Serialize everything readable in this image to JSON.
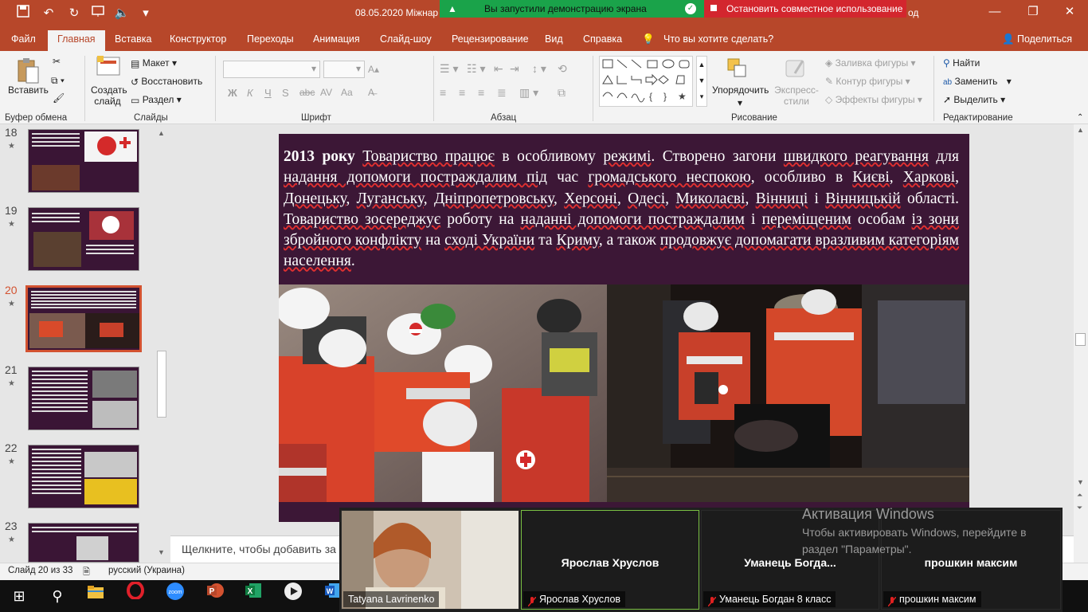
{
  "titlebar": {
    "doc_title": "08.05.2020 Міжнар",
    "behind_text": "од",
    "share_status": "Вы запустили демонстрацию экрана",
    "stop_share": "Остановить совместное использование"
  },
  "tabs": [
    {
      "label": "Файл"
    },
    {
      "label": "Главная",
      "active": true
    },
    {
      "label": "Вставка"
    },
    {
      "label": "Конструктор"
    },
    {
      "label": "Переходы"
    },
    {
      "label": "Анимация"
    },
    {
      "label": "Слайд-шоу"
    },
    {
      "label": "Рецензирование"
    },
    {
      "label": "Вид"
    },
    {
      "label": "Справка"
    },
    {
      "label": "Что вы хотите сделать?"
    },
    {
      "label": "Поделиться"
    }
  ],
  "ribbon": {
    "paste": "Вставить",
    "new_slide": "Создать слайд",
    "layout": "Макет",
    "reset": "Восстановить",
    "section": "Раздел",
    "arrange": "Упорядочить",
    "quick_styles": "Экспресс-стили",
    "shape_fill": "Заливка фигуры",
    "shape_outline": "Контур фигуры",
    "shape_effects": "Эффекты фигуры",
    "find": "Найти",
    "replace": "Заменить",
    "select": "Выделить",
    "groups": {
      "clipboard": "Буфер обмена",
      "slides": "Слайды",
      "font": "Шрифт",
      "paragraph": "Абзац",
      "drawing": "Рисование",
      "editing": "Редактирование"
    },
    "font_btns": [
      "Ж",
      "К",
      "Ч",
      "S",
      "abc",
      "AV",
      "Aa"
    ]
  },
  "thumbnails": [
    {
      "num": "18",
      "star": "★"
    },
    {
      "num": "19",
      "star": "★"
    },
    {
      "num": "20",
      "star": "★",
      "selected": true
    },
    {
      "num": "21",
      "star": "★"
    },
    {
      "num": "22",
      "star": "★"
    },
    {
      "num": "23",
      "star": "★"
    }
  ],
  "slide": {
    "year": "2013 року",
    "text_parts": [
      {
        "t": " ",
        "u": false
      },
      {
        "t": "Товариство працює",
        "u": true
      },
      {
        "t": " в особливому ",
        "u": false
      },
      {
        "t": "режимі",
        "u": true
      },
      {
        "t": ". Створено загони ",
        "u": false
      },
      {
        "t": "швидкого реагування",
        "u": true
      },
      {
        "t": " для ",
        "u": false
      },
      {
        "t": "надання допомоги постраждалим під",
        "u": true
      },
      {
        "t": " час ",
        "u": false
      },
      {
        "t": "громадського неспокою",
        "u": true
      },
      {
        "t": ", особливо в ",
        "u": false
      },
      {
        "t": "Києві",
        "u": true
      },
      {
        "t": ", ",
        "u": false
      },
      {
        "t": "Харкові",
        "u": true
      },
      {
        "t": ", ",
        "u": false
      },
      {
        "t": "Донецьку",
        "u": true
      },
      {
        "t": ", ",
        "u": false
      },
      {
        "t": "Луганську",
        "u": true
      },
      {
        "t": ", ",
        "u": false
      },
      {
        "t": "Дніпропетровську",
        "u": true
      },
      {
        "t": ", ",
        "u": false
      },
      {
        "t": "Херсоні",
        "u": true
      },
      {
        "t": ", ",
        "u": false
      },
      {
        "t": "Одесі",
        "u": true
      },
      {
        "t": ", ",
        "u": false
      },
      {
        "t": "Миколаєві",
        "u": true
      },
      {
        "t": ", ",
        "u": false
      },
      {
        "t": "Вінниці",
        "u": true
      },
      {
        "t": " і ",
        "u": false
      },
      {
        "t": "Вінницькій",
        "u": true
      },
      {
        "t": " області. ",
        "u": false
      },
      {
        "t": "Товариство зосереджує",
        "u": true
      },
      {
        "t": " роботу на ",
        "u": false
      },
      {
        "t": "наданні допомоги постраждалим",
        "u": true
      },
      {
        "t": " і ",
        "u": false
      },
      {
        "t": "переміщеним",
        "u": true
      },
      {
        "t": " особам ",
        "u": false
      },
      {
        "t": "із зони збройного конфлікту",
        "u": true
      },
      {
        "t": " на ",
        "u": false
      },
      {
        "t": "сході України",
        "u": true
      },
      {
        "t": " та ",
        "u": false
      },
      {
        "t": "Криму",
        "u": true
      },
      {
        "t": ", а також ",
        "u": false
      },
      {
        "t": "продовжує допомагати вразливим категоріям населення",
        "u": true
      },
      {
        "t": ".",
        "u": false
      }
    ]
  },
  "notes_placeholder": "Щелкните, чтобы добавить за",
  "status": {
    "slide_count": "Слайд 20 из 33",
    "language": "русский (Украина)"
  },
  "participants": [
    {
      "tile_name": "",
      "label": "Tatyana Lavrinenko",
      "muted": false,
      "video": true
    },
    {
      "tile_name": "Ярослав Хруслов",
      "label": "Ярослав Хруслов",
      "muted": true,
      "video": false
    },
    {
      "tile_name": "Уманець  Богда...",
      "label": "Уманець Богдан 8 класс",
      "muted": true,
      "video": false
    },
    {
      "tile_name": "прошкин максим",
      "label": "прошкин максим",
      "muted": true,
      "video": false
    }
  ],
  "watermark": {
    "title": "Активация Windows",
    "line1": "Чтобы активировать Windows, перейдите в",
    "line2": "раздел \"Параметры\"."
  },
  "colors": {
    "accent": "#b7472a",
    "slide_bg": "#3c1736",
    "share_green": "#1aa34a",
    "share_red": "#d3262e"
  }
}
